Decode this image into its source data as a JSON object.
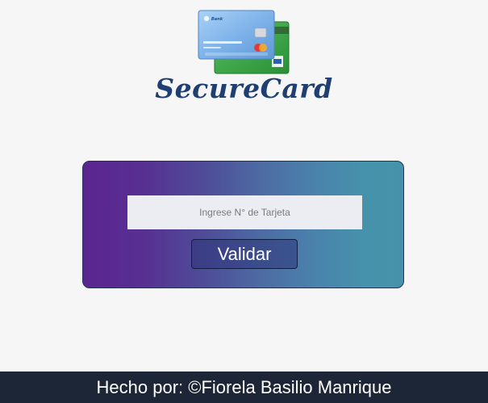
{
  "brand": {
    "name": "SecureCard",
    "logo_icon": "credit-cards-icon",
    "logo_card_text": "Bank",
    "colors": {
      "name": "#1f3f72",
      "card_front": "#7fb3ea",
      "card_back": "#3faa4a"
    }
  },
  "form": {
    "card_number_placeholder": "Ingrese N° de Tarjeta",
    "card_number_value": "",
    "validate_label": "Validar",
    "colors": {
      "gradient_start": "#5b2590",
      "gradient_end": "#4593a9",
      "input_background": "#ecedf2"
    }
  },
  "footer": {
    "credit": "Hecho por: ©Fiorela Basilio Manrique",
    "colors": {
      "background": "#1d2636",
      "text": "#ffffff"
    }
  }
}
